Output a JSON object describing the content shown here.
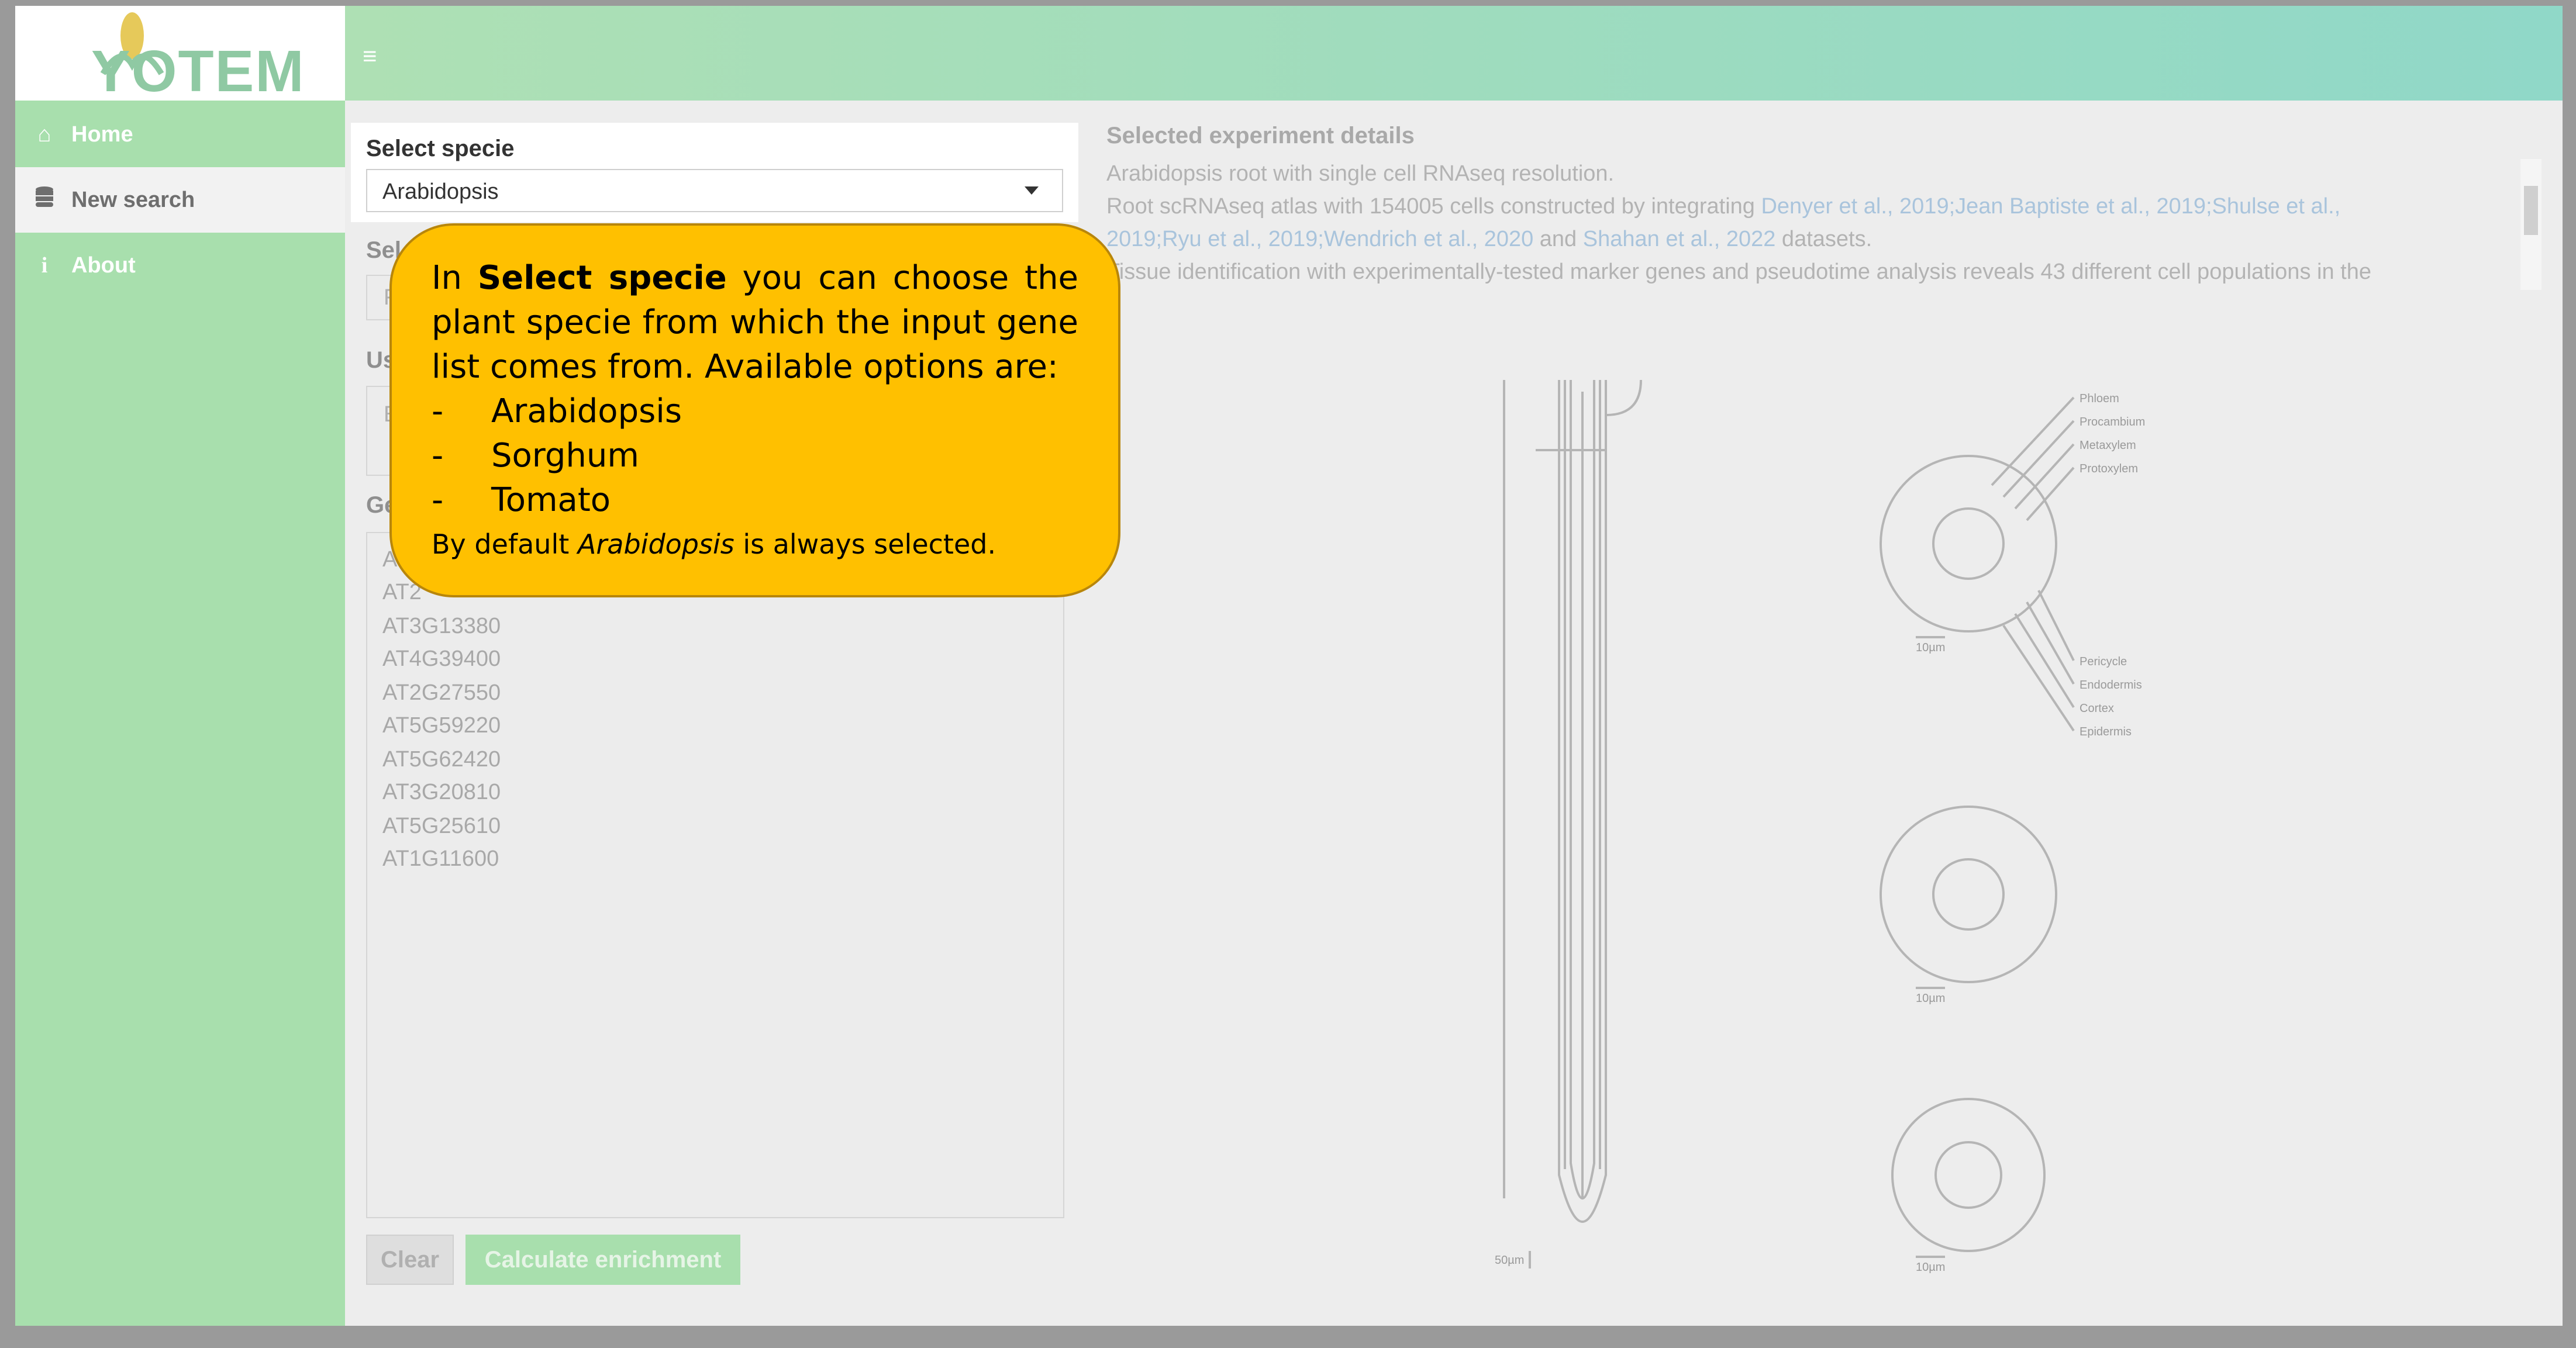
{
  "app": {
    "logo_text": "YOTEM"
  },
  "sidebar": {
    "items": [
      {
        "label": "Home",
        "icon": "home-icon"
      },
      {
        "label": "New search",
        "icon": "database-icon"
      },
      {
        "label": "About",
        "icon": "info-icon"
      }
    ],
    "active": "New search"
  },
  "form": {
    "select_specie_label": "Select specie",
    "select_specie_value": "Arabidopsis",
    "select2_label_partial": "Sel",
    "select2_value_partial": "F",
    "use_label_partial": "Us",
    "use_value_partial": "E",
    "genes_label_partial": "Ge",
    "genes": [
      "A",
      "AT2",
      "AT3G13380",
      "AT4G39400",
      "AT2G27550",
      "AT5G59220",
      "AT5G62420",
      "AT3G20810",
      "AT5G25610",
      "AT1G11600"
    ],
    "clear_label": "Clear",
    "calculate_label": "Calculate enrichment"
  },
  "details": {
    "title": "Selected experiment details",
    "line1": "Arabidopsis root with single cell RNAseq resolution.",
    "line2_prefix": "Root scRNAseq atlas with 154005 cells constructed by integrating ",
    "line2_links": "Denyer et al., 2019;Jean Baptiste et al., 2019;Shulse et al.,",
    "line3_links": "2019;Ryu et al., 2019;Wendrich et al., 2020",
    "line3_and": " and ",
    "line3_link2": "Shahan et al., 2022",
    "line3_suffix": " datasets.",
    "line4": "Tissue identification with experimentally-tested marker genes and pseudotime analysis reveals 43 different cell populations in the"
  },
  "diagram": {
    "labels_top": [
      "Phloem",
      "Procambium",
      "Metaxylem",
      "Protoxylem"
    ],
    "labels_bottom": [
      "Pericycle",
      "Endodermis",
      "Cortex",
      "Epidermis"
    ],
    "scale_small": "10µm",
    "scale_large": "50µm"
  },
  "tooltip": {
    "intro_pre": "In ",
    "intro_bold": "Select specie",
    "intro_post": " you can choose the plant specie from which the input gene list comes from. Available options are:",
    "options": [
      "Arabidopsis",
      "Sorghum",
      "Tomato"
    ],
    "dash": "-",
    "footer_pre": "By default ",
    "footer_italic": "Arabidopsis",
    "footer_post": " is always selected."
  },
  "colors": {
    "sidebar": "#a8dfad",
    "tooltip": "#ffc000",
    "link": "#a9c4dc"
  }
}
